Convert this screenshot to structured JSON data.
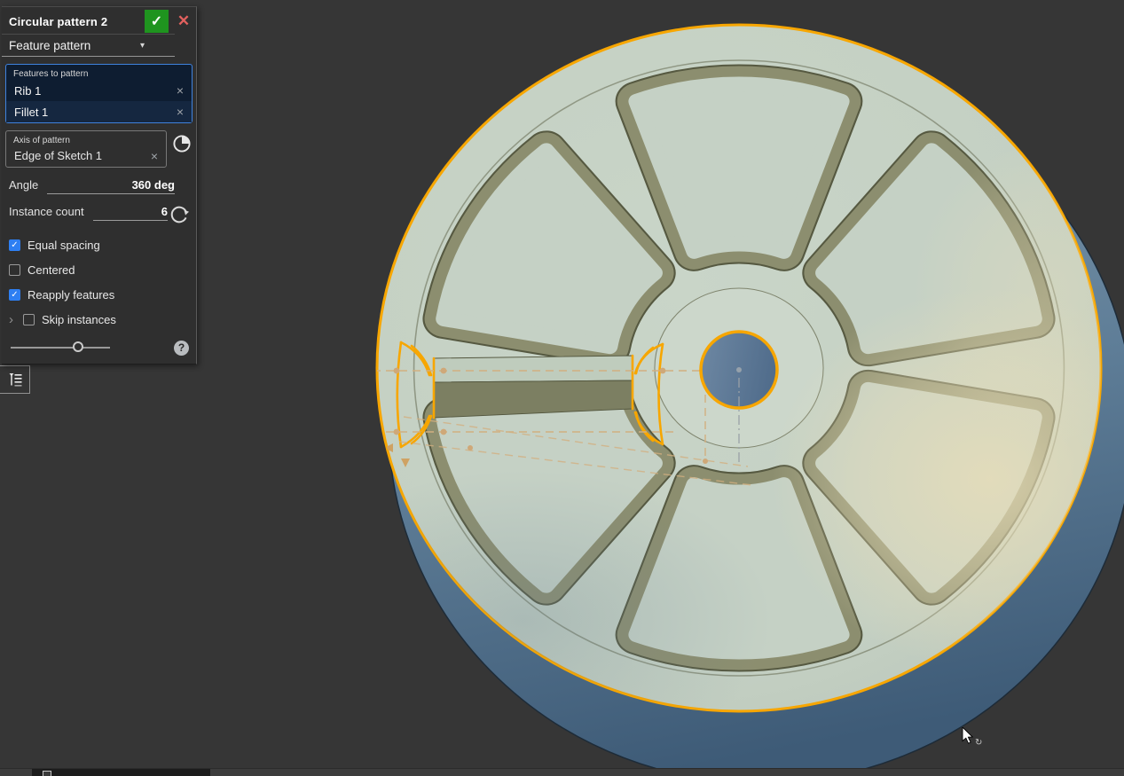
{
  "glyphs": {
    "check": "✓",
    "close": "✕",
    "caret": "▾",
    "remove": "×",
    "chevron": "›",
    "help": "?",
    "cursor_badge": "↻"
  },
  "colors": {
    "accent_orange": "#F7A600",
    "selection_border_blue": "#3F82DD",
    "selection_bg_navy": "#0E1D31",
    "checkbox_blue": "#2E7FF2",
    "confirm_green": "#1F941F",
    "cancel_red": "#E2615E",
    "part_top_sage": "#C5D1C5",
    "part_recess_wall_olive": "#8C8E6F",
    "base_cylinder_blue": "#5E7D97",
    "viewport_bg": "#363636"
  },
  "dialog": {
    "title": "Circular pattern 2",
    "pattern_type": "Feature pattern",
    "features_box": {
      "label": "Features to pattern",
      "items": [
        "Rib 1",
        "Fillet 1"
      ]
    },
    "axis_box": {
      "label": "Axis of pattern",
      "value": "Edge of Sketch 1"
    },
    "angle": {
      "label": "Angle",
      "value": "360 deg"
    },
    "instance_count": {
      "label": "Instance count",
      "value": "6"
    },
    "checkboxes": [
      {
        "label": "Equal spacing",
        "checked": true
      },
      {
        "label": "Centered",
        "checked": false
      },
      {
        "label": "Reapply features",
        "checked": true
      },
      {
        "label": "Skip instances",
        "checked": false
      }
    ]
  }
}
